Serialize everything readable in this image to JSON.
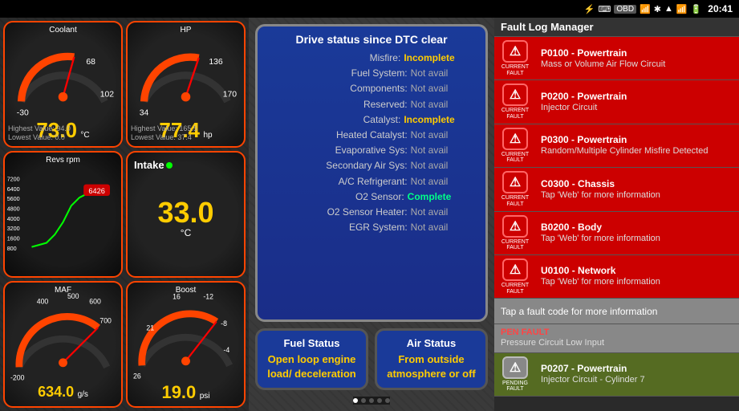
{
  "statusBar": {
    "time": "20:41",
    "icons": [
      "⚡",
      "⌨",
      "OBD",
      "📶",
      "🔊",
      "📶",
      "🔋"
    ]
  },
  "gauges": {
    "coolant": {
      "title": "Coolant",
      "value": "73.0",
      "unit": "°C",
      "highest": "Highest Value: 94.0",
      "lowest": "Lowest Value: 0.0",
      "min": -30,
      "max": 130,
      "current": 73
    },
    "hp": {
      "title": "HP",
      "value": "77.4",
      "unit": "hp",
      "highest": "Highest Value: 165.5",
      "lowest": "Lowest Value: 37.4",
      "min": 0,
      "max": 170,
      "current": 77
    },
    "revs": {
      "title": "Revs rpm",
      "value": "6426",
      "unit": "rpm"
    },
    "intake": {
      "title": "Intake",
      "value": "33.0",
      "unit": "°C"
    },
    "maf": {
      "title": "MAF",
      "value": "634.0",
      "unit": "g/s",
      "min": -200,
      "max": 700
    },
    "boost": {
      "title": "Boost",
      "value": "19.0",
      "unit": "psi",
      "min": -20,
      "max": 26
    }
  },
  "dtc": {
    "title": "Drive status since DTC clear",
    "rows": [
      {
        "label": "Misfire:",
        "value": "Incomplete",
        "type": "incomplete"
      },
      {
        "label": "Fuel System:",
        "value": "Not avail",
        "type": "notavail"
      },
      {
        "label": "Components:",
        "value": "Not avail",
        "type": "notavail"
      },
      {
        "label": "Reserved:",
        "value": "Not avail",
        "type": "notavail"
      },
      {
        "label": "Catalyst:",
        "value": "Incomplete",
        "type": "incomplete"
      },
      {
        "label": "Heated Catalyst:",
        "value": "Not avail",
        "type": "notavail"
      },
      {
        "label": "Evaporative Sys:",
        "value": "Not avail",
        "type": "notavail"
      },
      {
        "label": "Secondary Air Sys:",
        "value": "Not avail",
        "type": "notavail"
      },
      {
        "label": "A/C Refrigerant:",
        "value": "Not avail",
        "type": "notavail"
      },
      {
        "label": "O2 Sensor:",
        "value": "Complete",
        "type": "complete"
      },
      {
        "label": "O2 Sensor Heater:",
        "value": "Not avail",
        "type": "notavail"
      },
      {
        "label": "EGR System:",
        "value": "Not avail",
        "type": "notavail"
      }
    ]
  },
  "statusBoxes": {
    "fuel": {
      "title": "Fuel Status",
      "value": "Open loop engine load/ deceleration"
    },
    "air": {
      "title": "Air Status",
      "value": "From outside atmosphere or off"
    }
  },
  "faultLog": {
    "header": "Fault Log Manager",
    "faults": [
      {
        "code": "P0100 - Powertrain",
        "desc": "Mass or Volume Air Flow Circuit",
        "badge": "CURRENT\nFAULT",
        "type": "current"
      },
      {
        "code": "P0200 - Powertrain",
        "desc": "Injector Circuit",
        "badge": "CURRENT\nFAULT",
        "type": "current"
      },
      {
        "code": "P0300 - Powertrain",
        "desc": "Random/Multiple Cylinder Misfire Detected",
        "badge": "CURRENT\nFAULT",
        "type": "current"
      },
      {
        "code": "C0300 - Chassis",
        "desc": "Tap 'Web' for more information",
        "badge": "CURRENT\nFAULT",
        "type": "current"
      },
      {
        "code": "B0200 - Body",
        "desc": "Tap 'Web' for more information",
        "badge": "CURRENT\nFAULT",
        "type": "current"
      },
      {
        "code": "U0100 - Network",
        "desc": "Tap 'Web' for more information",
        "badge": "CURRENT\nFAULT",
        "type": "current"
      }
    ],
    "tapInfo": "Tap a fault code for more information",
    "pendingCode": "PEN FAULT",
    "pendingDesc": "Pressure Circuit Low Input",
    "pendingFault": {
      "code": "P0207 - Powertrain",
      "desc": "Injector Circuit - Cylinder 7",
      "badge": "PENDING\nFAULT",
      "type": "pending"
    }
  },
  "dots": {
    "left": [
      0,
      1,
      2,
      3,
      4
    ],
    "leftActive": 0,
    "middle": [
      0,
      1,
      2,
      3,
      4
    ],
    "middleActive": 0
  }
}
